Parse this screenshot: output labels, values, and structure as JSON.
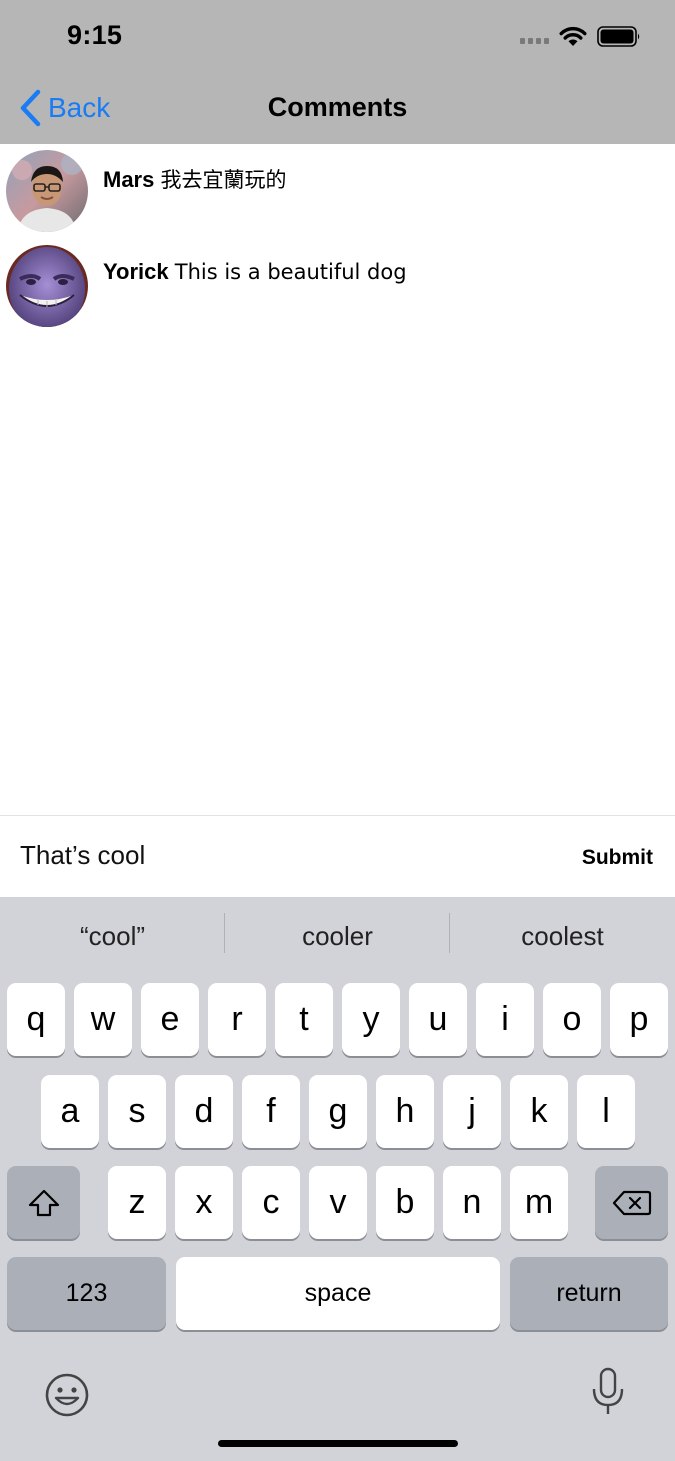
{
  "status_bar": {
    "time": "9:15"
  },
  "nav": {
    "back_label": "Back",
    "title": "Comments"
  },
  "comments": [
    {
      "user": "Mars",
      "text": "我去宜蘭玩的"
    },
    {
      "user": "Yorick",
      "text": "This is a beautiful dog"
    }
  ],
  "composer": {
    "value": "That’s cool",
    "submit_label": "Submit"
  },
  "keyboard": {
    "suggestions": [
      "“cool”",
      "cooler",
      "coolest"
    ],
    "row1": [
      "q",
      "w",
      "e",
      "r",
      "t",
      "y",
      "u",
      "i",
      "o",
      "p"
    ],
    "row2": [
      "a",
      "s",
      "d",
      "f",
      "g",
      "h",
      "j",
      "k",
      "l"
    ],
    "row3": [
      "z",
      "x",
      "c",
      "v",
      "b",
      "n",
      "m"
    ],
    "numbers_label": "123",
    "space_label": "space",
    "return_label": "return",
    "icons": {
      "shift": "shift-icon",
      "delete": "backspace-icon",
      "emoji": "emoji-icon",
      "mic": "microphone-icon"
    }
  },
  "colors": {
    "nav_background": "#b6b6b6",
    "accent": "#1a7cf5",
    "keyboard_background": "#d1d3d9",
    "special_key": "#abafb8"
  }
}
